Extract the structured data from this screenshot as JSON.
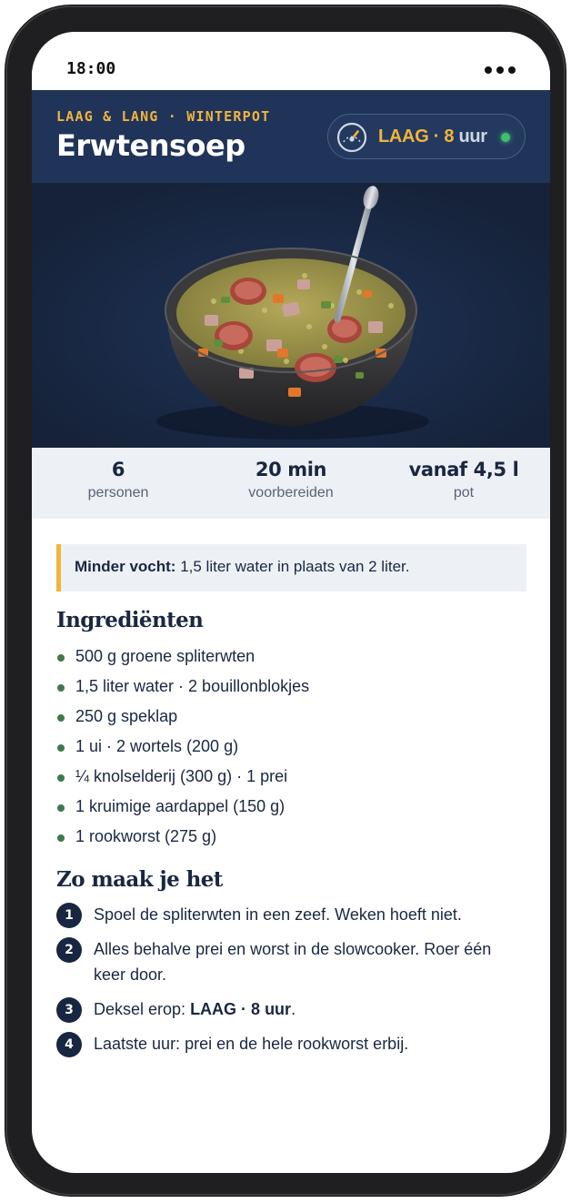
{
  "status_bar": {
    "time": "18:00"
  },
  "header": {
    "kicker": "LAAG & LANG · WINTERPOT",
    "title": "Erwtensoep",
    "timer": {
      "setting": "LAAG",
      "separator": "·",
      "hours": "8",
      "unit": "uur",
      "icon": "gauge-icon",
      "status_color": "#3fbf6a"
    }
  },
  "hero": {
    "image": "bowl-of-pea-soup-with-sausage"
  },
  "stats": [
    {
      "value": "6",
      "label": "personen"
    },
    {
      "value": "20 min",
      "label": "voorbereiden"
    },
    {
      "value": "vanaf 4,5 l",
      "label": "pot"
    }
  ],
  "note": {
    "label": "Minder vocht:",
    "text": "1,5 liter water in plaats van 2 liter."
  },
  "ingredients": {
    "title": "Ingrediënten",
    "items": [
      "500 g groene spliterwten",
      "1,5 liter water · 2 bouillonblokjes",
      "250 g speklap",
      "1 ui · 2 wortels (200 g)",
      "¼ knolselderij (300 g) · 1 prei",
      "1 kruimige aardappel (150 g)",
      "1 rookworst (275 g)"
    ]
  },
  "steps": {
    "title": "Zo maak je het",
    "items": [
      {
        "num": "1",
        "text": "Spoel de spliterwten in een zeef. Weken hoeft niet."
      },
      {
        "num": "2",
        "text": "Alles behalve prei en worst in de slowcooker. Roer één keer door."
      },
      {
        "num": "3",
        "text_before": "Deksel erop: ",
        "bold": "LAAG · 8 uur",
        "text_after": "."
      },
      {
        "num": "4",
        "text": "Laatste uur: prei en de hele rookworst erbij."
      }
    ]
  },
  "colors": {
    "navy": "#203459",
    "accent": "#f2b43d",
    "bullet": "#3f7a4a",
    "panel": "#edf1f6"
  }
}
